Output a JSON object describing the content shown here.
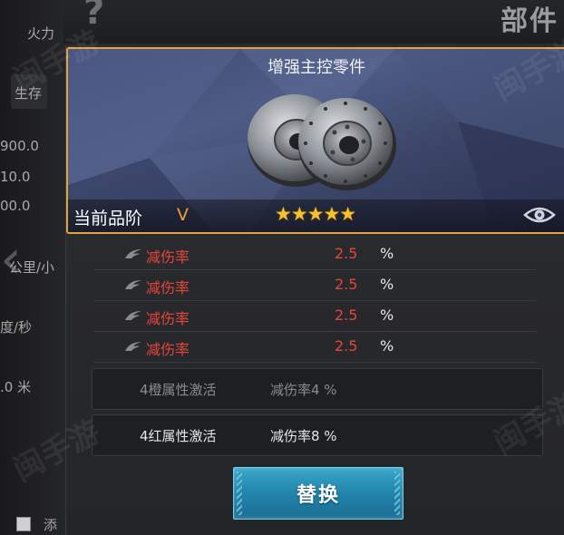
{
  "header": {
    "page_title": "部件",
    "help_icon": "?"
  },
  "background": {
    "side_texts": [
      "火力",
      "生存",
      "900.0",
      "10.0",
      "00.0",
      "公里/小",
      "度/秒",
      ".0 米",
      "添"
    ]
  },
  "item": {
    "name": "增强主控零件",
    "grade_label": "当前品阶",
    "grade_value": "V",
    "stars": "★★★★★",
    "star_count": 5,
    "icon": "brake-disc-icon",
    "border_color": "#e2a23f"
  },
  "attributes": [
    {
      "name": "减伤率",
      "value": "2.5",
      "unit": "%"
    },
    {
      "name": "减伤率",
      "value": "2.5",
      "unit": "%"
    },
    {
      "name": "减伤率",
      "value": "2.5",
      "unit": "%"
    },
    {
      "name": "减伤率",
      "value": "2.5",
      "unit": "%"
    }
  ],
  "set_bonuses": [
    {
      "name": "4橙属性激活",
      "effect": "减伤率4 %",
      "active": false
    },
    {
      "name": "4红属性激活",
      "effect": "减伤率8 %",
      "active": true
    }
  ],
  "actions": {
    "replace_label": "替换"
  },
  "colors": {
    "accent": "#e2a23f",
    "attribute_red": "#e5453a",
    "grade_orange": "#f0a030",
    "button_blue": "#2284aa"
  }
}
